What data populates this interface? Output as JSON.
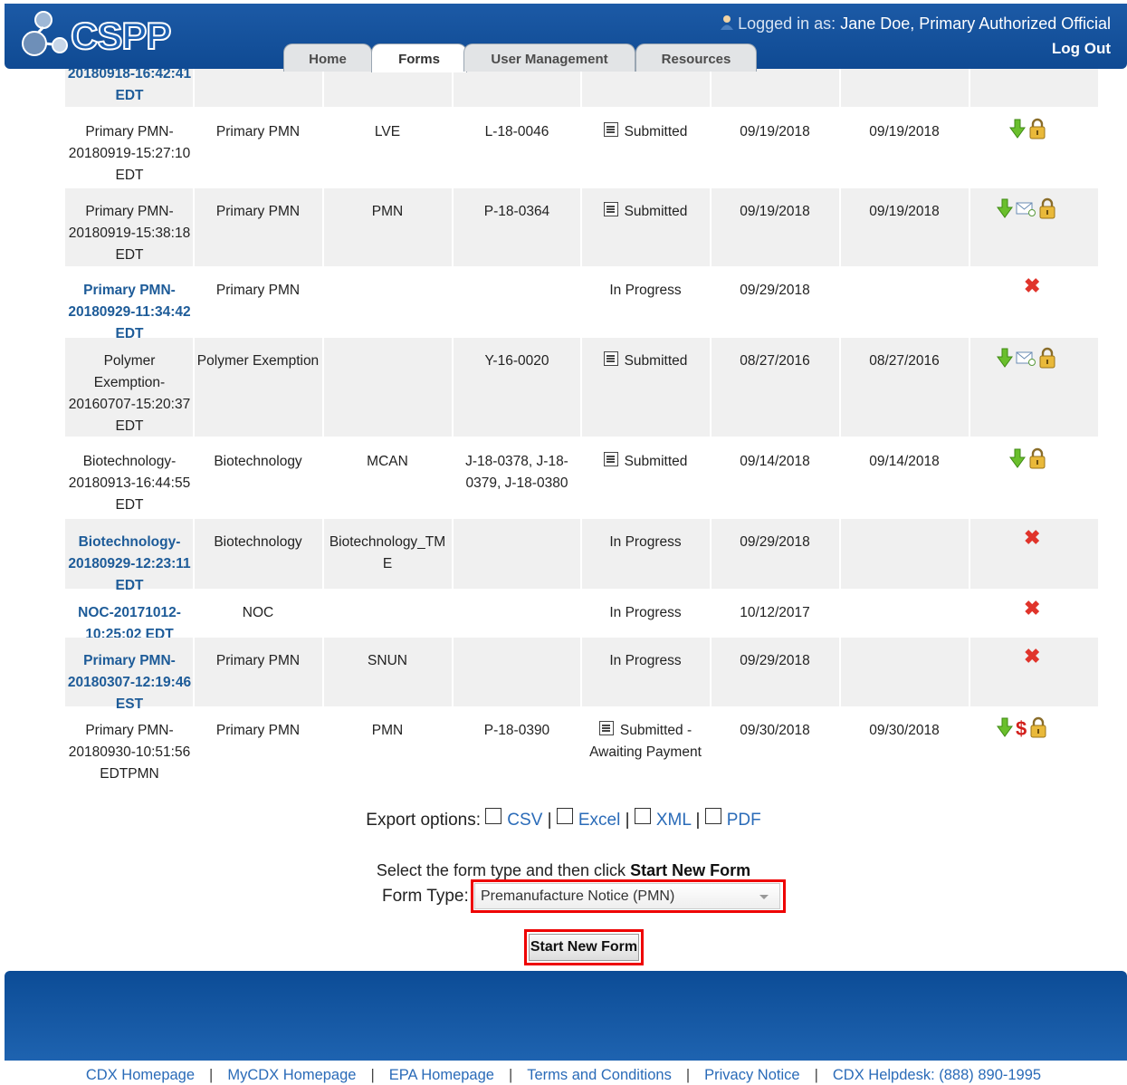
{
  "header": {
    "logo_text": "CSPP",
    "tabs": [
      {
        "label": "Home"
      },
      {
        "label": "Forms"
      },
      {
        "label": "User Management"
      },
      {
        "label": "Resources"
      }
    ],
    "active_tab": "Forms",
    "logged_in_label": "Logged in as:",
    "logged_in_user": "Jane Doe, Primary Authorized Official",
    "logout_label": "Log Out"
  },
  "table": {
    "partial_top_row": {
      "name_line": "20180918-16:42:41",
      "name_tail": "EDT"
    },
    "rows": [
      {
        "name": [
          "Primary PMN-",
          "20180919-15:27:10",
          "EDT"
        ],
        "name_link": false,
        "form_type": "Primary PMN",
        "sub_type": "LVE",
        "case_number": "L-18-0046",
        "status": [
          "Submitted"
        ],
        "status_icon": true,
        "created": "09/19/2018",
        "submitted": "09/19/2018",
        "actions": [
          "download-icon",
          "lock-icon"
        ]
      },
      {
        "name": [
          "Primary PMN-",
          "20180919-15:38:18",
          "EDT"
        ],
        "name_link": false,
        "form_type": "Primary PMN",
        "sub_type": "PMN",
        "case_number": "P-18-0364",
        "status": [
          "Submitted"
        ],
        "status_icon": true,
        "created": "09/19/2018",
        "submitted": "09/19/2018",
        "actions": [
          "download-icon",
          "mail-icon",
          "lock-icon"
        ]
      },
      {
        "name": [
          "Primary PMN-",
          "20180929-11:34:42",
          "EDT"
        ],
        "name_link": true,
        "form_type": "Primary PMN",
        "sub_type": "",
        "case_number": "",
        "status": [
          "In Progress"
        ],
        "status_icon": false,
        "created": "09/29/2018",
        "submitted": "",
        "actions": [
          "delete-icon"
        ]
      },
      {
        "name": [
          "Polymer",
          "Exemption-",
          "20160707-15:20:37",
          "EDT"
        ],
        "name_link": false,
        "form_type": "Polymer Exemption",
        "sub_type": "",
        "case_number": "Y-16-0020",
        "status": [
          "Submitted"
        ],
        "status_icon": true,
        "created": "08/27/2016",
        "submitted": "08/27/2016",
        "actions": [
          "download-icon",
          "mail-icon",
          "lock-icon"
        ]
      },
      {
        "name": [
          "Biotechnology-",
          "20180913-16:44:55",
          "EDT"
        ],
        "name_link": false,
        "form_type": "Biotechnology",
        "sub_type": "MCAN",
        "case_number": "J-18-0378, J-18-\n0379, J-18-0380",
        "status": [
          "Submitted"
        ],
        "status_icon": true,
        "created": "09/14/2018",
        "submitted": "09/14/2018",
        "actions": [
          "download-icon",
          "lock-icon"
        ]
      },
      {
        "name": [
          "Biotechnology-",
          "20180929-12:23:11",
          "EDT"
        ],
        "name_link": true,
        "form_type": "Biotechnology",
        "sub_type": "Biotechnology_TM\nE",
        "case_number": "",
        "status": [
          "In Progress"
        ],
        "status_icon": false,
        "created": "09/29/2018",
        "submitted": "",
        "actions": [
          "delete-icon"
        ]
      },
      {
        "name": [
          "NOC-20171012-",
          "10:25:02 EDT"
        ],
        "name_link": true,
        "form_type": "NOC",
        "sub_type": "",
        "case_number": "",
        "status": [
          "In Progress"
        ],
        "status_icon": false,
        "created": "10/12/2017",
        "submitted": "",
        "actions": [
          "delete-icon"
        ]
      },
      {
        "name": [
          "Primary PMN-",
          "20180307-12:19:46",
          "EST"
        ],
        "name_link": true,
        "form_type": "Primary PMN",
        "sub_type": "SNUN",
        "case_number": "",
        "status": [
          "In Progress"
        ],
        "status_icon": false,
        "created": "09/29/2018",
        "submitted": "",
        "actions": [
          "delete-icon"
        ]
      },
      {
        "name": [
          "Primary PMN-",
          "20180930-10:51:56",
          "EDTPMN"
        ],
        "name_link": false,
        "form_type": "Primary PMN",
        "sub_type": "PMN",
        "case_number": "P-18-0390",
        "status": [
          "Submitted -",
          "Awaiting Payment"
        ],
        "status_icon": true,
        "created": "09/30/2018",
        "submitted": "09/30/2018",
        "actions": [
          "download-icon",
          "dollar-icon",
          "lock-icon"
        ]
      }
    ]
  },
  "export": {
    "label": "Export options:",
    "options": [
      {
        "label": "CSV"
      },
      {
        "label": "Excel"
      },
      {
        "label": "XML"
      },
      {
        "label": "PDF"
      }
    ],
    "separator": "|"
  },
  "new_form": {
    "instruction_prefix": "Select the form type and then click",
    "instruction_bold": "Start New Form",
    "form_type_label": "Form Type:",
    "form_type_value": "Premanufacture Notice (PMN)",
    "start_button": "Start New Form"
  },
  "footer": {
    "links": [
      "CDX Homepage",
      "MyCDX Homepage",
      "EPA Homepage",
      "Terms and Conditions",
      "Privacy Notice",
      "CDX Helpdesk: (888) 890-1995"
    ],
    "separator": "|"
  },
  "colors": {
    "header_blue": "#1c5aa6",
    "link_blue": "#1d5b98",
    "highlight_red": "#ee0000",
    "row_shade": "#f0f0f0"
  }
}
